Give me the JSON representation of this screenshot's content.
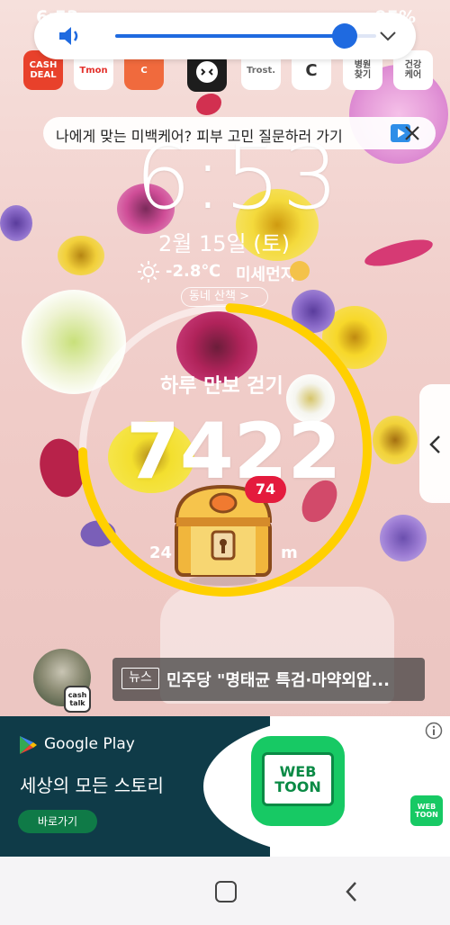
{
  "status_bar": {
    "time": "6:53",
    "battery": "95%"
  },
  "volume": {
    "level_percent": 88,
    "icon": "speaker-icon",
    "expand_icon": "chevron-down-icon"
  },
  "apps": [
    {
      "label": "CASH DEAL",
      "bg": "#e8412b",
      "fg": "#ffffff"
    },
    {
      "label": "Tmon",
      "bg": "#ffffff",
      "fg": "#e3312c"
    },
    {
      "label": "C",
      "bg": "#f06a3d",
      "fg": "#ffffff"
    },
    {
      "label": "",
      "bg": "#1d1d1d",
      "fg": "#ffffff"
    },
    {
      "label": "Trost.",
      "bg": "#ffffff",
      "fg": "#6d6d6d"
    },
    {
      "label": "C",
      "bg": "#ffffff",
      "fg": "#333333"
    },
    {
      "label": "병원\n찾기",
      "bg": "#ffffff",
      "fg": "#555555"
    },
    {
      "label": "건강\n케어",
      "bg": "#ffffff",
      "fg": "#555555"
    }
  ],
  "banner": {
    "text": "나에게 맞는 미백케어? 피부 고민 질문하러 가기"
  },
  "lockscreen": {
    "clock": "6:53",
    "date": "2월 15일 (토)",
    "temperature": "-2.8℃",
    "air_quality": "미세먼지",
    "neighborhood_chip": "동네 산책 >"
  },
  "walking": {
    "title": "하루 만보 걷기",
    "steps": "7422",
    "goal_progress": 0.742,
    "reward_badge": "74",
    "distance_start": "24",
    "distance_end": "m"
  },
  "news": {
    "tag": "뉴스",
    "headline": "민주당 \"명태균 특검·마약외압..."
  },
  "cashtalk": {
    "label": "cash talk"
  },
  "ad": {
    "store_name": "Google Play",
    "headline": "세상의 모든 스토리",
    "cta": "바로가기",
    "brand_line1": "WEB",
    "brand_line2": "TOON",
    "small_brand": "WEB TOON"
  },
  "colors": {
    "accent_blue": "#1f6ae0",
    "ring_yellow": "#ffd000",
    "badge_red": "#e41b3d",
    "ad_dark": "#0f3b48",
    "webtoon_green": "#17c964"
  }
}
